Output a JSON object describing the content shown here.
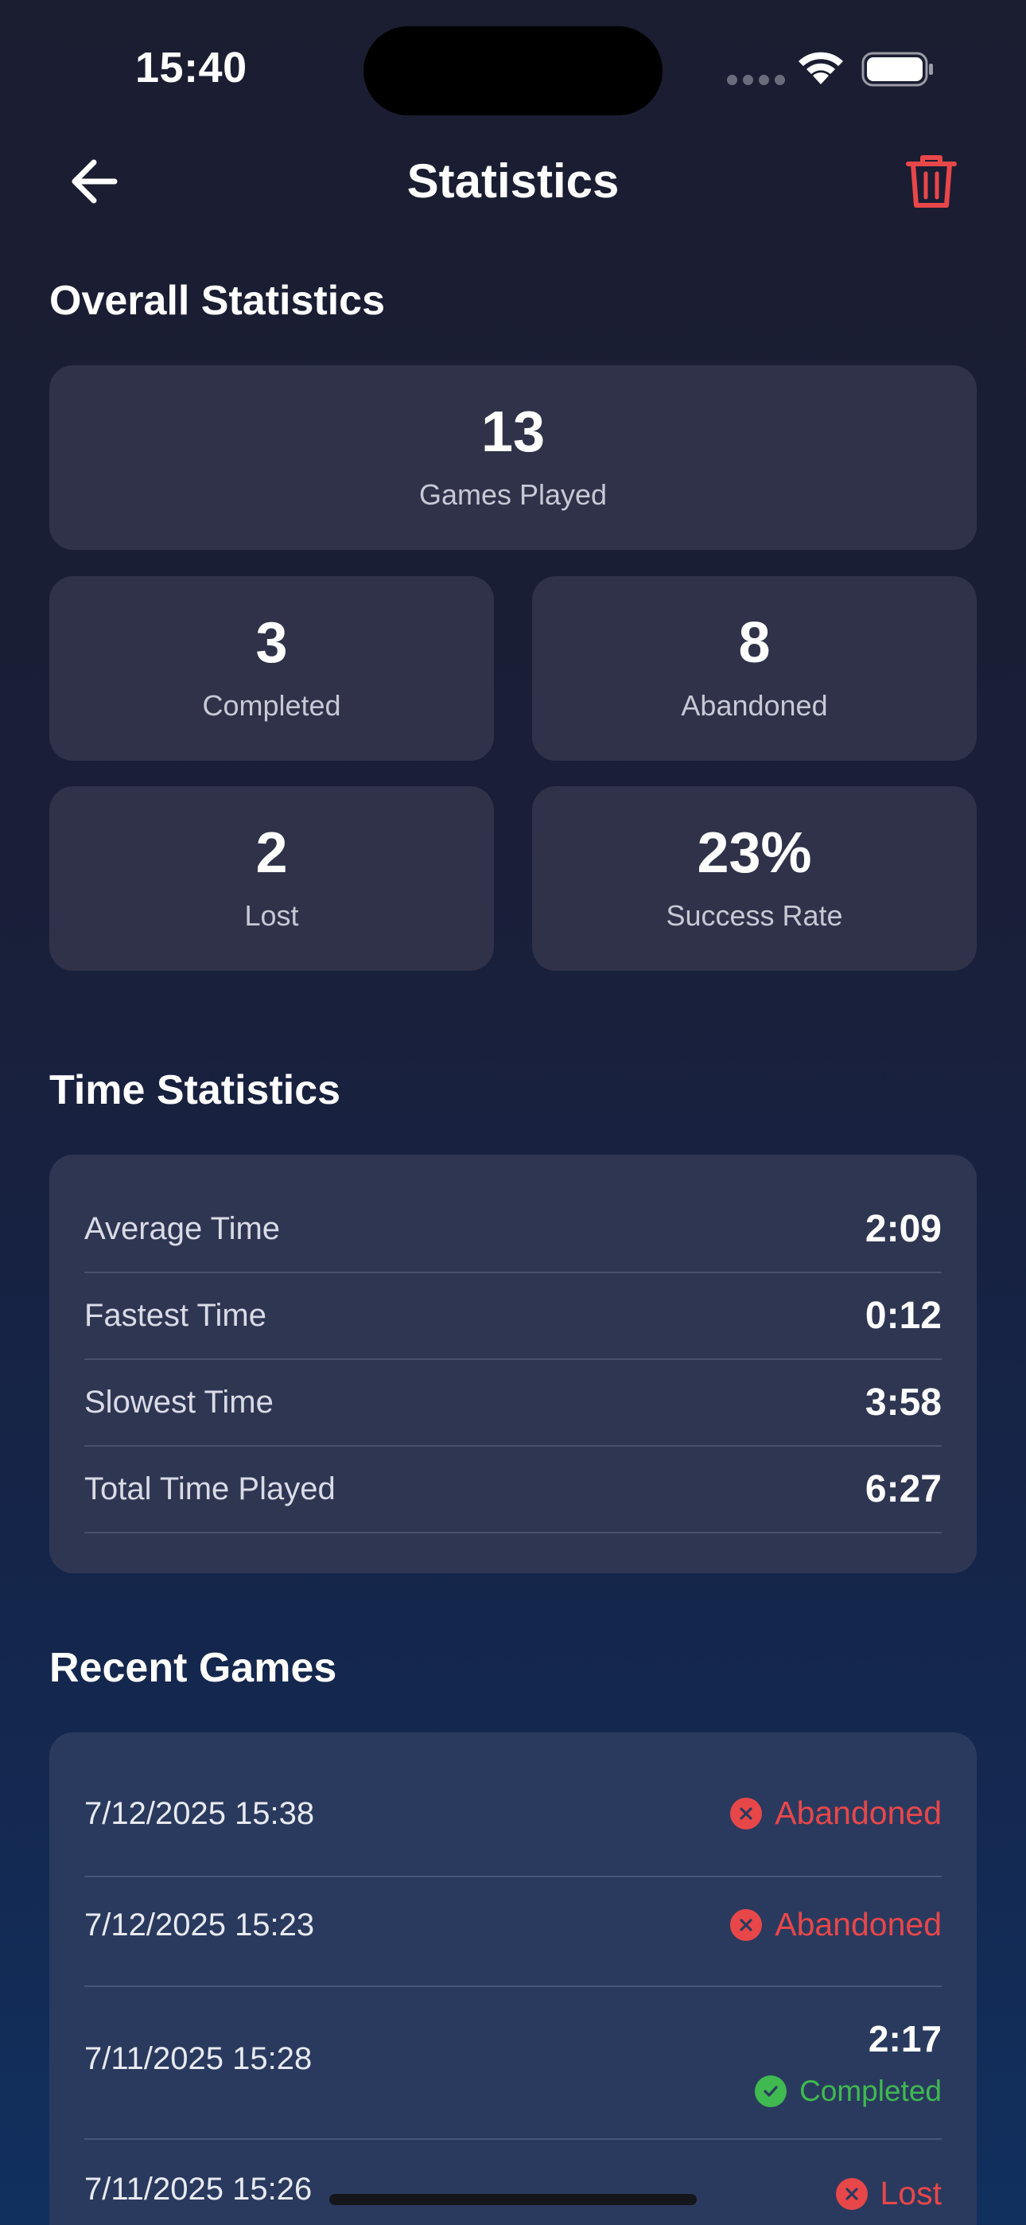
{
  "status_bar": {
    "time": "15:40",
    "signal_icon": "signal-dots-icon",
    "wifi_icon": "wifi-icon",
    "battery_icon": "battery-icon"
  },
  "header": {
    "title": "Statistics",
    "back_icon": "arrow-left-icon",
    "delete_icon": "trash-icon"
  },
  "colors": {
    "danger": "#e8474a",
    "success": "#3fb950",
    "card": "#2f3249",
    "panel": "#2e3652"
  },
  "overall": {
    "title": "Overall Statistics",
    "games_played": {
      "value": "13",
      "label": "Games Played"
    },
    "completed": {
      "value": "3",
      "label": "Completed"
    },
    "abandoned": {
      "value": "8",
      "label": "Abandoned"
    },
    "lost": {
      "value": "2",
      "label": "Lost"
    },
    "success_rate": {
      "value": "23%",
      "label": "Success Rate"
    }
  },
  "time_stats": {
    "title": "Time Statistics",
    "rows": [
      {
        "label": "Average Time",
        "value": "2:09"
      },
      {
        "label": "Fastest Time",
        "value": "0:12"
      },
      {
        "label": "Slowest Time",
        "value": "3:58"
      },
      {
        "label": "Total Time Played",
        "value": "6:27"
      }
    ]
  },
  "recent": {
    "title": "Recent Games",
    "games": [
      {
        "date": "7/12/2025 15:38",
        "status": "Abandoned",
        "icon": "x-circle-icon"
      },
      {
        "date": "7/12/2025 15:23",
        "status": "Abandoned",
        "icon": "x-circle-icon"
      },
      {
        "date": "7/11/2025 15:28",
        "duration": "2:17",
        "status": "Completed",
        "icon": "check-circle-icon"
      },
      {
        "date": "7/11/2025 15:26",
        "status": "Lost",
        "icon": "x-circle-icon"
      }
    ]
  }
}
